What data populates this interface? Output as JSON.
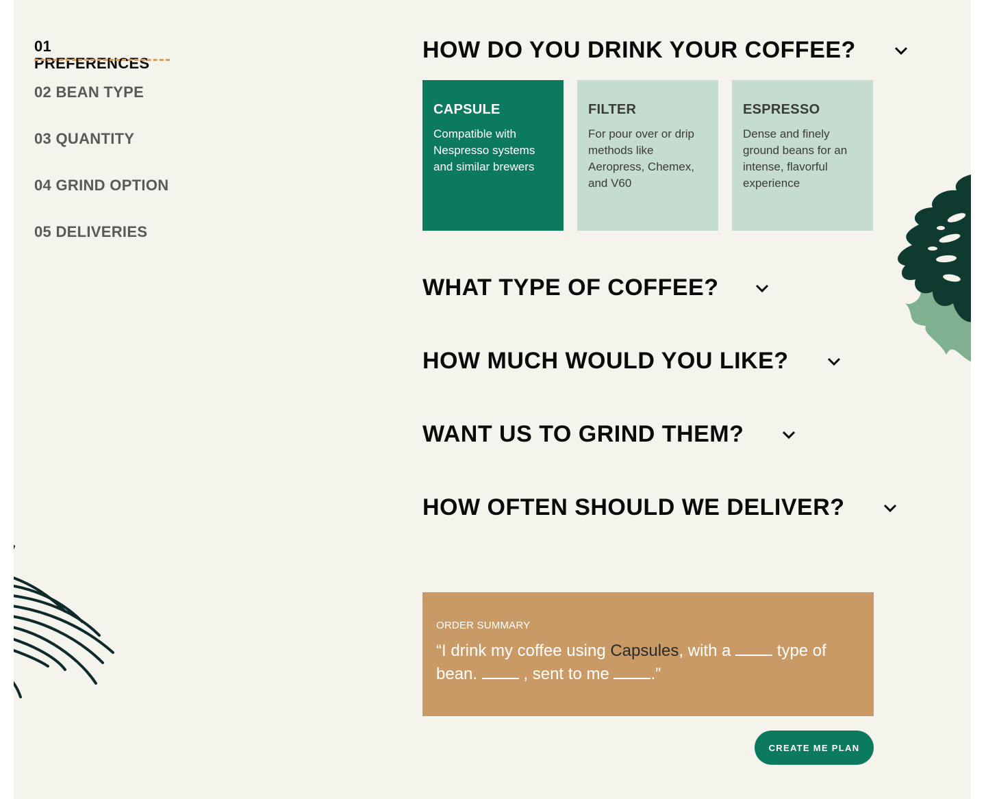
{
  "sidebar": {
    "active": {
      "number": "01",
      "label": "PREFERENCES"
    },
    "items": [
      {
        "label": "02 BEAN TYPE"
      },
      {
        "label": "03 QUANTITY"
      },
      {
        "label": "04 GRIND OPTION"
      },
      {
        "label": "05 DELIVERIES"
      }
    ]
  },
  "questions": [
    {
      "title": "HOW DO YOU DRINK YOUR COFFEE?"
    },
    {
      "title": "WHAT TYPE OF COFFEE?"
    },
    {
      "title": "HOW MUCH WOULD YOU LIKE?"
    },
    {
      "title": "WANT US TO GRIND THEM?"
    },
    {
      "title": "HOW OFTEN SHOULD WE DELIVER?"
    }
  ],
  "options": [
    {
      "title": "CAPSULE",
      "description": "Compatible with Nespresso systems and similar brewers",
      "selected": true
    },
    {
      "title": "FILTER",
      "description": "For pour over or drip methods like Aeropress, Chemex, and V60",
      "selected": false
    },
    {
      "title": "ESPRESSO",
      "description": "Dense and finely ground beans for an intense, flavorful experience",
      "selected": false
    }
  ],
  "summary": {
    "label": "ORDER SUMMARY",
    "part1": "“I drink my coffee using ",
    "highlight": "Capsules",
    "part2": ", with a ",
    "part3": " type of bean. ",
    "part4": " , sent to me ",
    "part5": ".”"
  },
  "cta": {
    "label": "CREATE ME PLAN"
  },
  "colors": {
    "background": "#f4f3ec",
    "accent_green": "#0c7a5e",
    "option_light": "#c5dcd0",
    "summary_bg": "#c99a65",
    "dash": "#d3a06a"
  },
  "icons": {
    "chevron": "chevron-down-icon",
    "leaf": "monstera-leaf-icon",
    "fern": "palm-leaf-icon"
  }
}
